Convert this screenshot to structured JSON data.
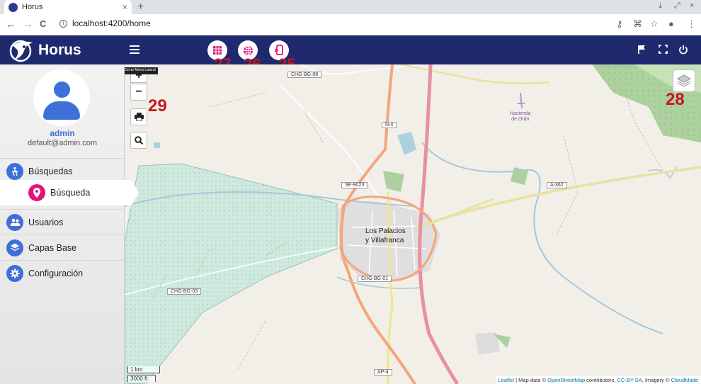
{
  "browser": {
    "tab_title": "Horus",
    "tab_close": "×",
    "new_tab": "+",
    "url": "localhost:4200/home",
    "back": "←",
    "forward": "→",
    "reload": "C",
    "info": "i",
    "window_controls": [
      "⤓",
      "⤢",
      "×"
    ],
    "right_icons": [
      "key-icon",
      "translate-icon",
      "star-icon",
      "account-icon",
      "menu-icon"
    ]
  },
  "app": {
    "title": "Horus",
    "toolbar_numbers": [
      "27",
      "26",
      "25"
    ],
    "header_right_icons": [
      "flag-icon",
      "fullscreen-icon",
      "power-icon"
    ]
  },
  "user": {
    "name": "admin",
    "email": "default@admin.com"
  },
  "sidebar": {
    "items": [
      {
        "label": "Búsquedas",
        "icon": "hiker-icon"
      },
      {
        "label": "Búsqueda",
        "icon": "location-pin-icon",
        "sub": true
      },
      {
        "label": "Usuarios",
        "icon": "users-icon"
      },
      {
        "label": "Capas Base",
        "icon": "layers-icon"
      },
      {
        "label": "Configuración",
        "icon": "gear-icon"
      }
    ]
  },
  "map": {
    "zoom_in": "+",
    "zoom_out": "−",
    "tooltip": "Abrir/Cerrar Menú Lateral",
    "label_29": "29",
    "label_28": "28",
    "scale_km": "1 km",
    "scale_ft": "3000 ft",
    "town": [
      "Los Palacios",
      "y Villafranca"
    ],
    "hacienda": [
      "Hacienda",
      "de Orán"
    ],
    "road_labels": [
      "CHG-BG-08",
      "N-4",
      "SE-9023",
      "A-362",
      "CHG-BG-01",
      "CHG-BG-03",
      "AP-4"
    ],
    "attribution": {
      "leaflet": "Leaflet",
      "sep1": " | Map data © ",
      "osm": "OpenStreetMap",
      "sep2": " contributors, ",
      "license": "CC-BY-SA",
      "sep3": ", Imagery © ",
      "imagery": "CloudMade"
    }
  },
  "colors": {
    "header": "#1f2a6e",
    "accent_blue": "#3f6fd9",
    "accent_pink": "#e0157a",
    "annotation_red": "#c6161c"
  }
}
